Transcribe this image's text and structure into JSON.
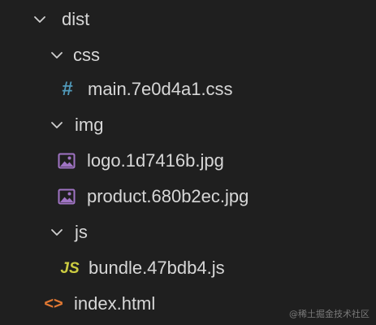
{
  "explorer": {
    "folders": {
      "dist": "dist",
      "css": "css",
      "img": "img",
      "js": "js"
    },
    "files": {
      "main_css": "main.7e0d4a1.css",
      "logo": "logo.1d7416b.jpg",
      "product": "product.680b2ec.jpg",
      "bundle": "bundle.47bdb4.js",
      "index": "index.html"
    },
    "icons": {
      "css_glyph": "#",
      "js_glyph": "JS",
      "html_glyph": "<>",
      "css_color": "#519aba",
      "js_color": "#cbcb41",
      "html_color": "#e37933",
      "image_color": "#a074c4"
    }
  },
  "watermark": "@稀土掘金技术社区"
}
